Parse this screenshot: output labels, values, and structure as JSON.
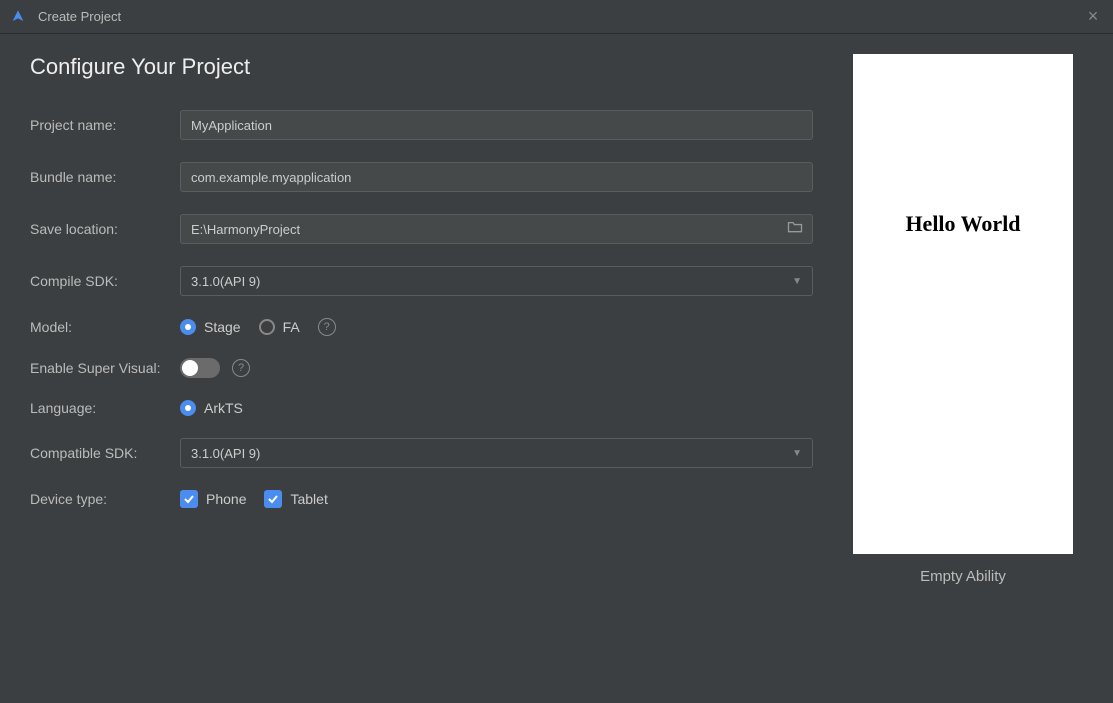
{
  "window": {
    "title": "Create Project"
  },
  "page": {
    "heading": "Configure Your Project"
  },
  "form": {
    "project_name": {
      "label": "Project name:",
      "value": "MyApplication"
    },
    "bundle_name": {
      "label": "Bundle name:",
      "value": "com.example.myapplication"
    },
    "save_location": {
      "label": "Save location:",
      "value": "E:\\HarmonyProject"
    },
    "compile_sdk": {
      "label": "Compile SDK:",
      "value": "3.1.0(API 9)"
    },
    "model": {
      "label": "Model:",
      "options": [
        {
          "label": "Stage",
          "checked": true
        },
        {
          "label": "FA",
          "checked": false
        }
      ]
    },
    "enable_super_visual": {
      "label": "Enable Super Visual:",
      "enabled": false
    },
    "language": {
      "label": "Language:",
      "options": [
        {
          "label": "ArkTS",
          "checked": true
        }
      ]
    },
    "compatible_sdk": {
      "label": "Compatible SDK:",
      "value": "3.1.0(API 9)"
    },
    "device_type": {
      "label": "Device type:",
      "options": [
        {
          "label": "Phone",
          "checked": true
        },
        {
          "label": "Tablet",
          "checked": true
        }
      ]
    }
  },
  "preview": {
    "content": "Hello World",
    "caption": "Empty Ability"
  }
}
